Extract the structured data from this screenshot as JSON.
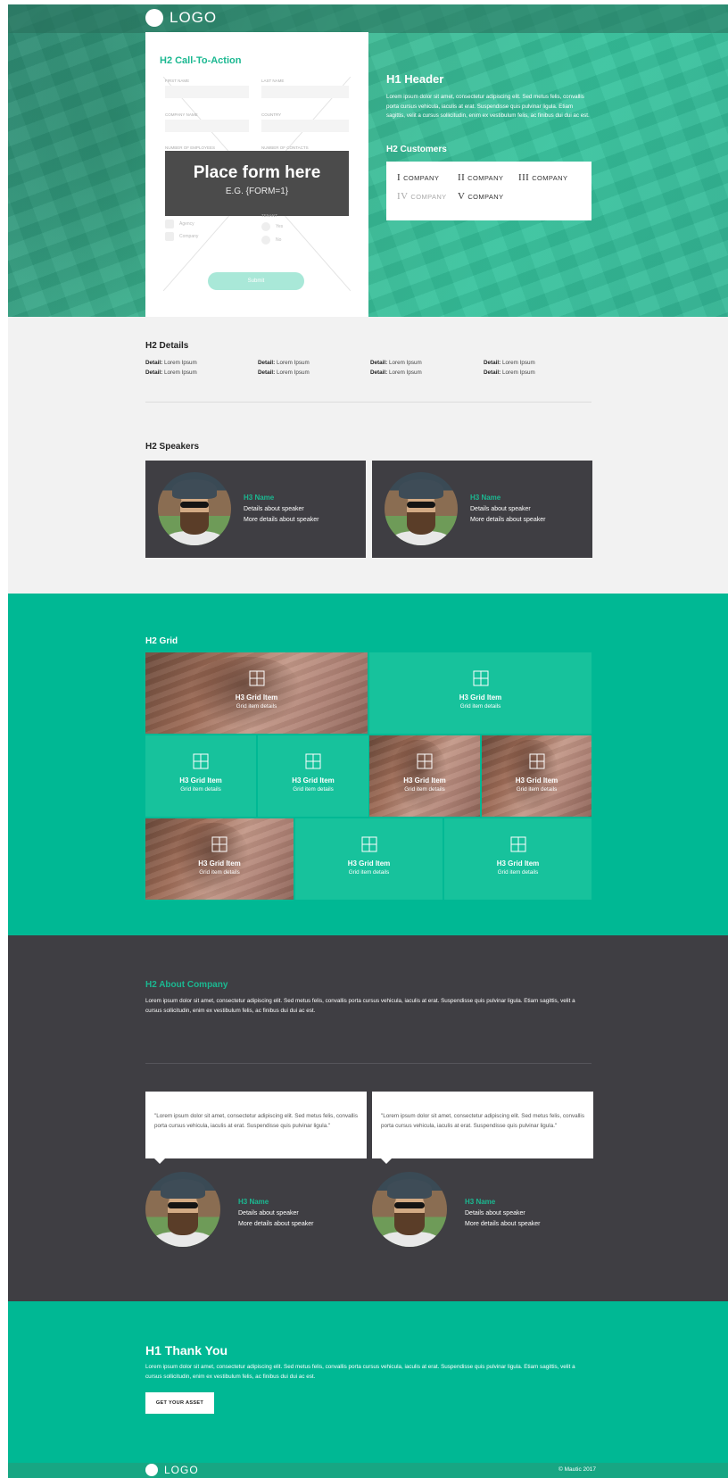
{
  "brand": {
    "logo_text": "LOGO",
    "accent": "#1bb891",
    "teal": "#00b894",
    "dark": "#3f3e43"
  },
  "hero": {
    "form": {
      "title": "H2 Call-To-Action",
      "fields": [
        "FIRST NAME",
        "LAST NAME",
        "COMPANY NAME",
        "COUNTRY",
        "NUMBER OF EMPLOYEES",
        "NUMBER OF CONTACTS"
      ],
      "options_left": [
        "Agency",
        "Company"
      ],
      "options_right_label": "TENANT",
      "options_right": [
        "Yes",
        "No"
      ],
      "placeholder_title": "Place form here",
      "placeholder_sub": "E.G. {FORM=1}",
      "submit_label": "Submit"
    },
    "h1": "H1 Header",
    "lorem": "Lorem ipsum dolor sit amet, consectetur adipiscing elit. Sed metus felis, convallis porta cursus vehicula, iaculis at erat. Suspendisse quis pulvinar ligula. Etiam sagittis, velit a cursus sollicitudin, enim ex vestibulum felis, ac finibus dui dui ac est.",
    "customers_title": "H2 Customers",
    "companies": [
      {
        "numeral": "I",
        "name": "COMPANY"
      },
      {
        "numeral": "II",
        "name": "COMPANY"
      },
      {
        "numeral": "III",
        "name": "COMPANY"
      },
      {
        "numeral": "IV",
        "name": "COMPANY"
      },
      {
        "numeral": "V",
        "name": "COMPANY"
      }
    ]
  },
  "details": {
    "title": "H2 Details",
    "label": "Detail:",
    "value": "Lorem Ipsum"
  },
  "speakers": {
    "title": "H2 Speakers",
    "items": [
      {
        "name": "H3 Name",
        "details": "Details about speaker",
        "more": "More details about speaker"
      },
      {
        "name": "H3 Name",
        "details": "Details about speaker",
        "more": "More details about speaker"
      }
    ]
  },
  "grid": {
    "title": "H2 Grid",
    "item_title": "H3 Grid Item",
    "item_details": "Grid item details"
  },
  "about": {
    "title": "H2 About Company",
    "lorem": "Lorem ipsum dolor sit amet, consectetur adipiscing elit. Sed metus felis, convallis porta cursus vehicula, iaculis at erat. Suspendisse quis pulvinar ligula. Etiam sagittis, velit a cursus sollicitudin, enim ex vestibulum felis, ac finibus dui dui ac est.",
    "testimonials": [
      {
        "quote": "\"Lorem ipsum dolor sit amet, consectetur adipiscing elit. Sed metus felis, convallis porta cursus vehicula, iaculis at erat. Suspendisse quis pulvinar ligula.\"",
        "name": "H3 Name",
        "details": "Details about speaker",
        "more": "More details about speaker"
      },
      {
        "quote": "\"Lorem ipsum dolor sit amet, consectetur adipiscing elit. Sed metus felis, convallis porta cursus vehicula, iaculis at erat. Suspendisse quis pulvinar ligula.\"",
        "name": "H3 Name",
        "details": "Details about speaker",
        "more": "More details about speaker"
      }
    ]
  },
  "thanks": {
    "title": "H1 Thank You",
    "lorem": "Lorem ipsum dolor sit amet, consectetur adipiscing elit. Sed metus felis, convallis porta cursus vehicula, iaculis at erat. Suspendisse quis pulvinar ligula. Etiam sagittis, velit a cursus sollicitudin, enim ex vestibulum felis, ac finibus dui dui ac est.",
    "button_label": "GET YOUR ASSET"
  },
  "footer": {
    "logo_text": "LOGO",
    "copyright": "© Mautic 2017"
  }
}
